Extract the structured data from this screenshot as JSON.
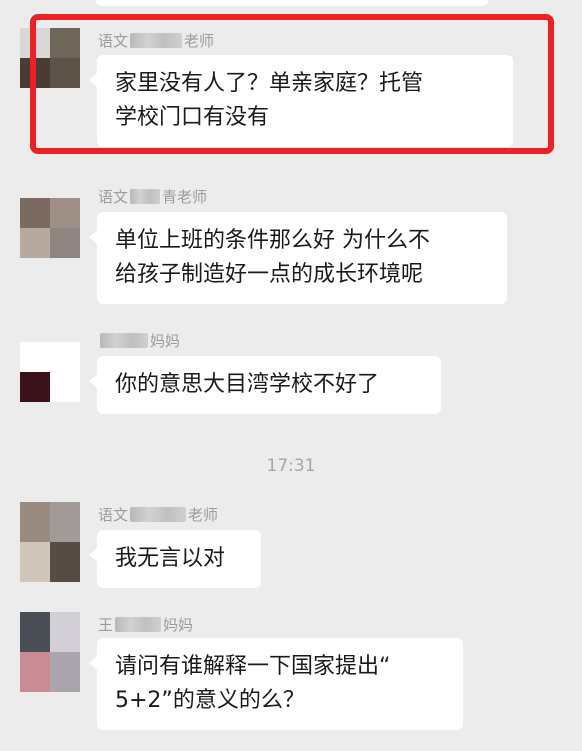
{
  "annotation": {
    "color": "#ee1f25"
  },
  "time_separator": "17:31",
  "messages": [
    {
      "sender_prefix": "语文",
      "sender_suffix": "老师",
      "text_lines": [
        "家里没有人了？单亲家庭？托管",
        "学校门口有没有"
      ],
      "highlighted": true
    },
    {
      "sender_prefix": "语文",
      "sender_suffix": "青老师",
      "text_lines": [
        "单位上班的条件那么好 为什么不",
        "给孩子制造好一点的成长环境呢"
      ]
    },
    {
      "sender_prefix": "",
      "sender_suffix": "妈妈",
      "text_lines": [
        "你的意思大目湾学校不好了"
      ]
    },
    {
      "sender_prefix": "语文",
      "sender_suffix": "老师",
      "text_lines": [
        "我无言以对"
      ]
    },
    {
      "sender_prefix": "王",
      "sender_suffix": "妈妈",
      "text_lines": [
        "请问有谁解释一下国家提出“",
        "5+2”的意义的么？"
      ]
    }
  ]
}
